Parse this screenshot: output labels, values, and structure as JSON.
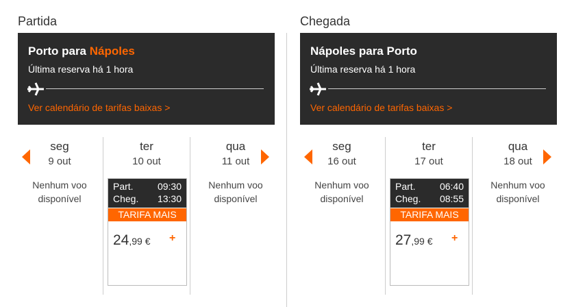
{
  "outbound": {
    "section_title": "Partida",
    "route_origin": "Porto para ",
    "route_destination": "Nápoles",
    "booking_info": "Última reserva há 1 hora",
    "calendar_link": "Ver calendário de tarifas baixas >",
    "days": [
      {
        "day": "seg",
        "date": "9 out",
        "no_flight": "Nenhum voo disponível"
      },
      {
        "day": "ter",
        "date": "10 out",
        "flight": {
          "dep_label": "Part.",
          "dep_time": "09:30",
          "arr_label": "Cheg.",
          "arr_time": "13:30",
          "fare": "TARIFA MAIS",
          "price_main": "24",
          "price_decimals": ",99 €",
          "add": "+"
        }
      },
      {
        "day": "qua",
        "date": "11 out",
        "no_flight": "Nenhum voo disponível"
      }
    ]
  },
  "return": {
    "section_title": "Chegada",
    "route": "Nápoles para Porto",
    "booking_info": "Última reserva há 1 hora",
    "calendar_link": "Ver calendário de tarifas baixas >",
    "days": [
      {
        "day": "seg",
        "date": "16 out",
        "no_flight": "Nenhum voo disponível"
      },
      {
        "day": "ter",
        "date": "17 out",
        "flight": {
          "dep_label": "Part.",
          "dep_time": "06:40",
          "arr_label": "Cheg.",
          "arr_time": "08:55",
          "fare": "TARIFA MAIS",
          "price_main": "27",
          "price_decimals": ",99 €",
          "add": "+"
        }
      },
      {
        "day": "qua",
        "date": "18 out",
        "no_flight": "Nenhum voo disponível"
      }
    ]
  },
  "icons": {
    "plane": "plane-icon",
    "prev": "arrow-left-icon",
    "next": "arrow-right-icon"
  },
  "colors": {
    "accent": "#ff6600",
    "dark": "#2b2b2b"
  }
}
